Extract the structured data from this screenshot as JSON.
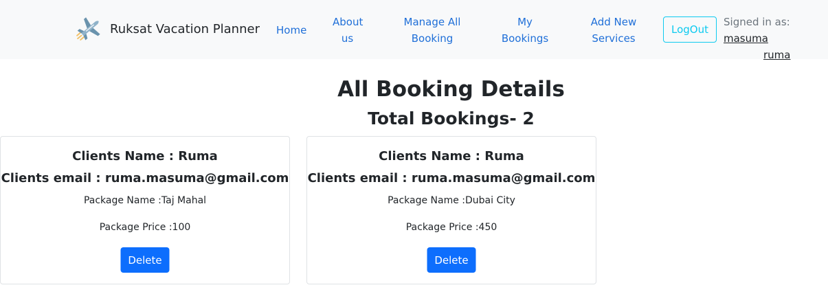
{
  "nav": {
    "brand": "Ruksat Vacation Planner",
    "links": [
      {
        "line1": "Home",
        "line2": ""
      },
      {
        "line1": "About",
        "line2": "us"
      },
      {
        "line1": "Manage All",
        "line2": "Booking"
      },
      {
        "line1": "My",
        "line2": "Bookings"
      },
      {
        "line1": "Add New",
        "line2": "Services"
      }
    ],
    "logout": "LogOut",
    "signed_in_label": "Signed in as:",
    "user_line1": "masuma",
    "user_line2": "ruma"
  },
  "page": {
    "title": "All Booking Details",
    "subtitle": "Total Bookings- 2"
  },
  "bookings": [
    {
      "client_name": "Clients Name : Ruma",
      "client_email": "Clients email : ruma.masuma@gmail.com",
      "package_name": "Package Name :Taj Mahal",
      "package_price": "Package Price :100",
      "delete_label": "Delete"
    },
    {
      "client_name": "Clients Name : Ruma",
      "client_email": "Clients email : ruma.masuma@gmail.com",
      "package_name": "Package Name :Dubai City",
      "package_price": "Package Price :450",
      "delete_label": "Delete"
    }
  ],
  "icons": {
    "brand_logo": "airplane-icon"
  },
  "colors": {
    "nav_bg": "#f8f9fa",
    "nav_link": "#1f6fd8",
    "logout_outline": "#0dcaf0",
    "delete_button": "#0d6efd"
  }
}
